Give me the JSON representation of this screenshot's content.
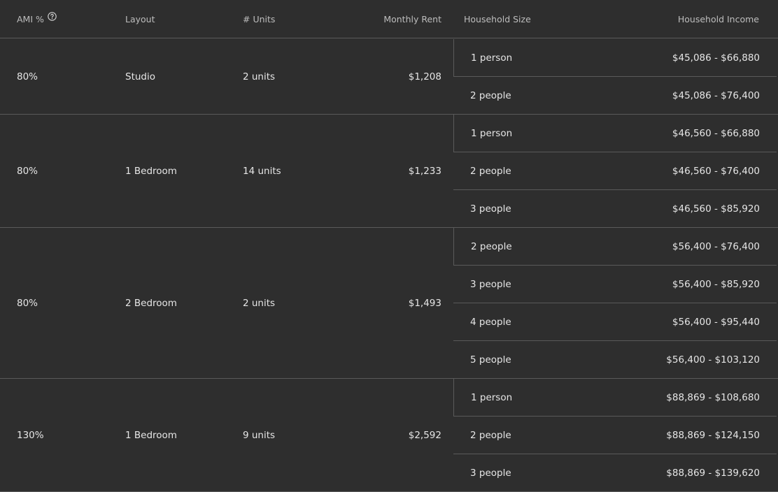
{
  "header": {
    "ami": "AMI %",
    "layout": "Layout",
    "units": "# Units",
    "rent": "Monthly Rent",
    "household_size": "Household Size",
    "household_income": "Household Income",
    "help_icon": "question-circle-icon"
  },
  "groups": [
    {
      "ami": "80%",
      "layout": "Studio",
      "units": "2 units",
      "rent": "$1,208",
      "rows": [
        {
          "size": "1 person",
          "income": "$45,086 - $66,880"
        },
        {
          "size": "2 people",
          "income": "$45,086 - $76,400"
        }
      ]
    },
    {
      "ami": "80%",
      "layout": "1 Bedroom",
      "units": "14 units",
      "rent": "$1,233",
      "rows": [
        {
          "size": "1 person",
          "income": "$46,560 - $66,880"
        },
        {
          "size": "2 people",
          "income": "$46,560 - $76,400"
        },
        {
          "size": "3 people",
          "income": "$46,560 - $85,920"
        }
      ]
    },
    {
      "ami": "80%",
      "layout": "2 Bedroom",
      "units": "2 units",
      "rent": "$1,493",
      "rows": [
        {
          "size": "2 people",
          "income": "$56,400 - $76,400"
        },
        {
          "size": "3 people",
          "income": "$56,400 - $85,920"
        },
        {
          "size": "4 people",
          "income": "$56,400 - $95,440"
        },
        {
          "size": "5 people",
          "income": "$56,400 - $103,120"
        }
      ]
    },
    {
      "ami": "130%",
      "layout": "1 Bedroom",
      "units": "9 units",
      "rent": "$2,592",
      "rows": [
        {
          "size": "1 person",
          "income": "$88,869 - $108,680"
        },
        {
          "size": "2 people",
          "income": "$88,869 - $124,150"
        },
        {
          "size": "3 people",
          "income": "$88,869 - $139,620"
        }
      ]
    }
  ]
}
